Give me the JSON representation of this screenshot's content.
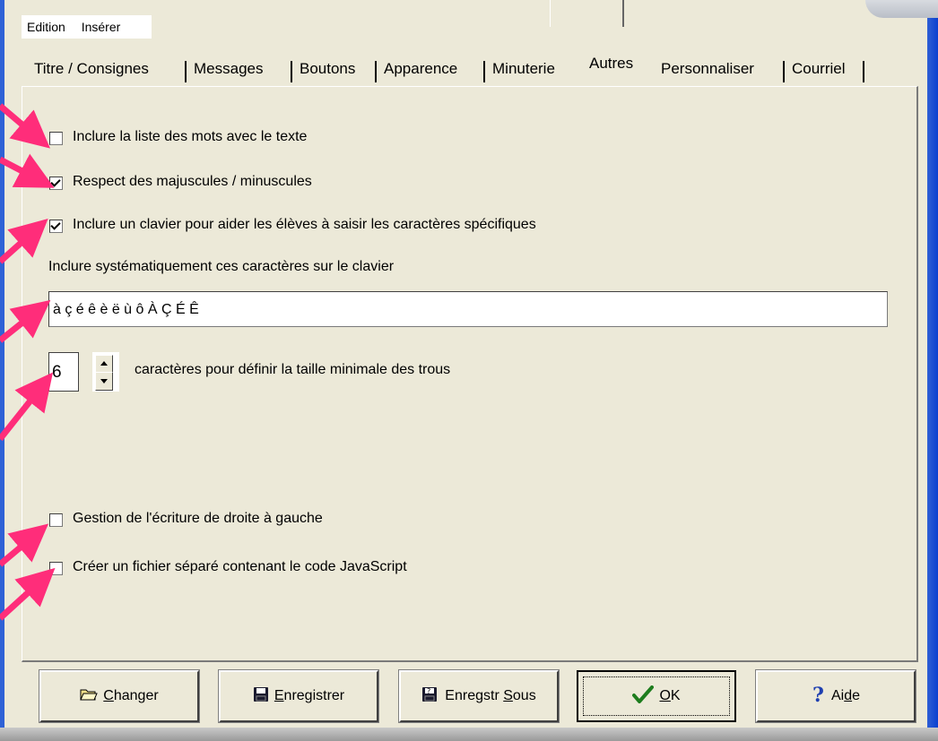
{
  "menu": {
    "items": [
      "Edition",
      "Insérer"
    ]
  },
  "tabs": [
    {
      "label": "Titre / Consignes",
      "active": false
    },
    {
      "label": "Messages",
      "active": false
    },
    {
      "label": "Boutons",
      "active": false
    },
    {
      "label": "Apparence",
      "active": false
    },
    {
      "label": "Minuterie",
      "active": false
    },
    {
      "label": "Autres",
      "active": true
    },
    {
      "label": "Personnaliser",
      "active": false
    },
    {
      "label": "Courriel",
      "active": false
    }
  ],
  "options": {
    "word_list": {
      "label": "Inclure la liste des mots avec le texte",
      "checked": false
    },
    "case_sensitive": {
      "label": "Respect des majuscules / minuscules",
      "checked": true
    },
    "keyboard": {
      "label": "Inclure un clavier pour aider les élèves à saisir les caractères spécifiques",
      "checked": true
    },
    "rtl": {
      "label": "Gestion de l'écriture de droite à gauche",
      "checked": false
    },
    "separate_js": {
      "label": "Créer un fichier séparé contenant le code JavaScript",
      "checked": false
    }
  },
  "keyboard_chars": {
    "label": "Inclure systématiquement ces caractères sur le clavier",
    "value": "à ç é ê è ë ù ô À Ç É Ê"
  },
  "gap_size": {
    "value": "6",
    "label": "caractères pour définir la taille minimale des trous"
  },
  "buttons": {
    "change": {
      "label_u": "C",
      "label_rest": "hanger"
    },
    "save": {
      "label_u": "E",
      "label_rest": "nregistrer"
    },
    "save_as": {
      "label_pre": "Enregstr ",
      "label_u": "S",
      "label_rest": "ous"
    },
    "ok": {
      "label_u": "O",
      "label_rest": "K"
    },
    "help": {
      "label_pre": "Ai",
      "label_u": "d",
      "label_rest": "e"
    }
  },
  "colors": {
    "annotation_arrow": "#ff2d7a",
    "window_face": "#ece9d8",
    "titlebar_blue": "#2f62d6"
  }
}
